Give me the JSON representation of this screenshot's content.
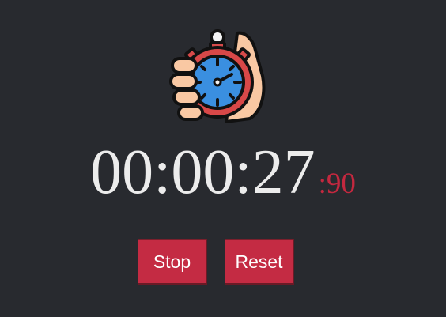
{
  "logo": {
    "icon": "stopwatch-in-hand-icon"
  },
  "timer": {
    "main": "00:00:27",
    "ms": ":90"
  },
  "controls": {
    "stop_label": "Stop",
    "reset_label": "Reset"
  },
  "colors": {
    "background": "#282a2f",
    "accent": "#c42b43",
    "time_text": "#ececec",
    "ms_text": "#c4283f"
  }
}
